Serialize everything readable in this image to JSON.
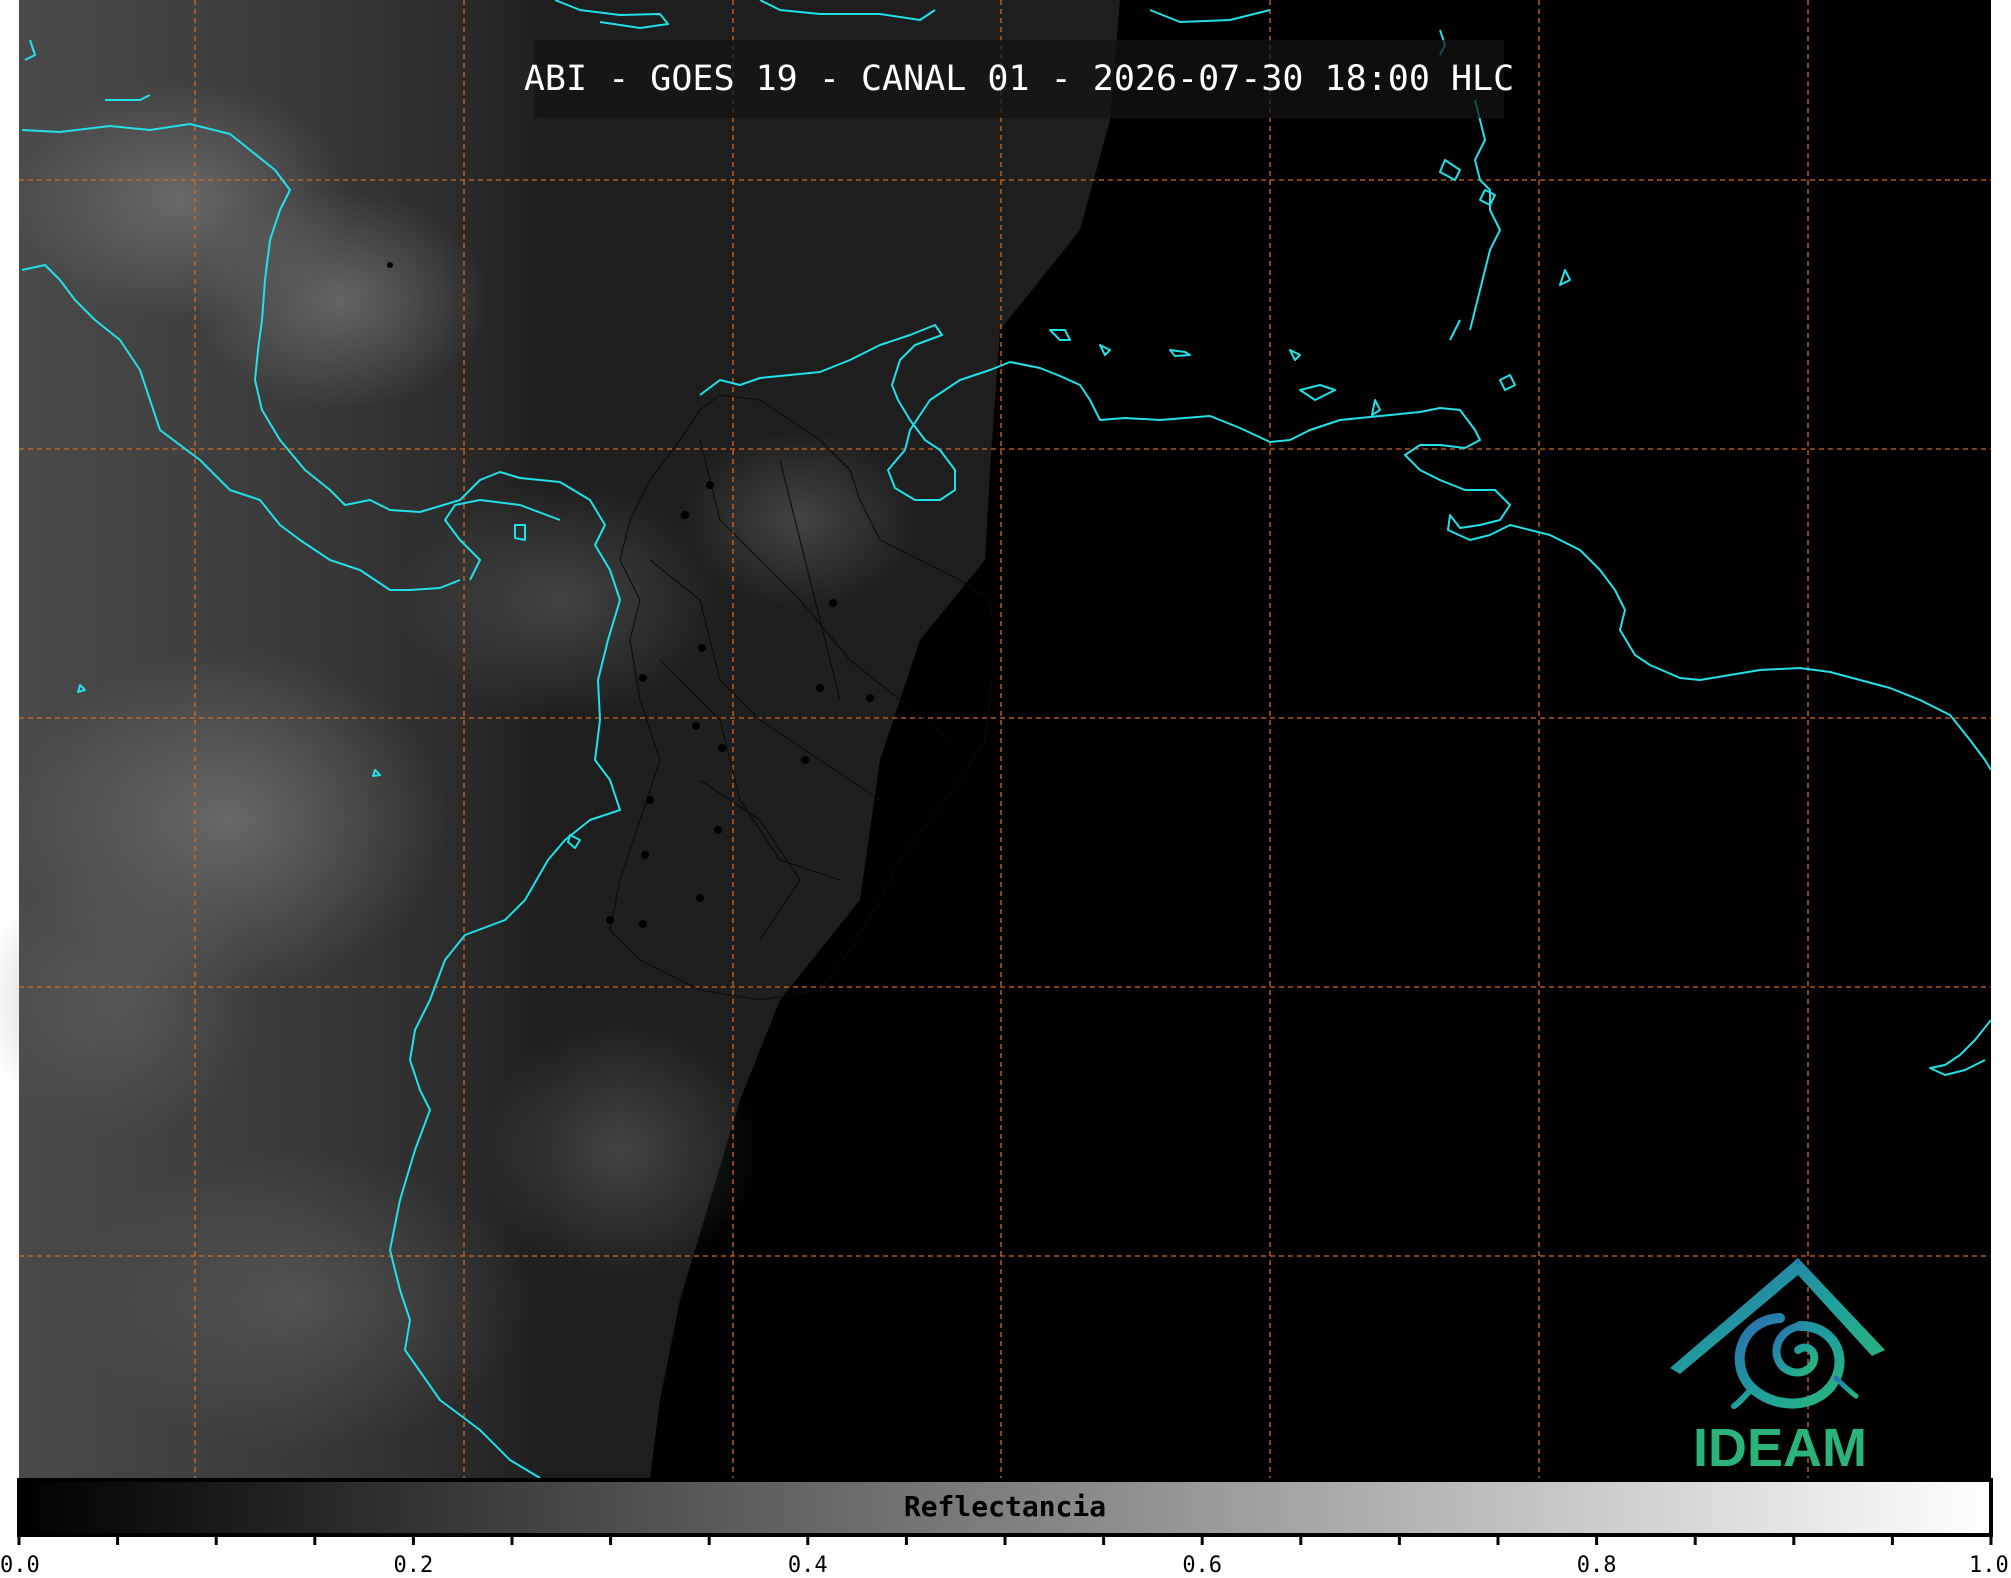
{
  "title": "ABI - GOES 19 - CANAL 01 - 2026-07-30 18:00 HLC",
  "colorbar": {
    "label": "Reflectancia",
    "range": [
      0.0,
      1.0
    ],
    "ticks": [
      "0.0",
      "0.2",
      "0.4",
      "0.6",
      "0.8",
      "1.0"
    ],
    "colormap": "grayscale black to white"
  },
  "logo": {
    "text": "IDEAM",
    "colors": [
      "#2a6fb0",
      "#1fa39a",
      "#2bb47a"
    ]
  },
  "map": {
    "grid_color": "#d2691e",
    "coastline_color": "#22e0e8",
    "border_color": "#000000",
    "grid_style": "dashed",
    "imagery": "visible reflectance, daylight over west, night over east"
  }
}
